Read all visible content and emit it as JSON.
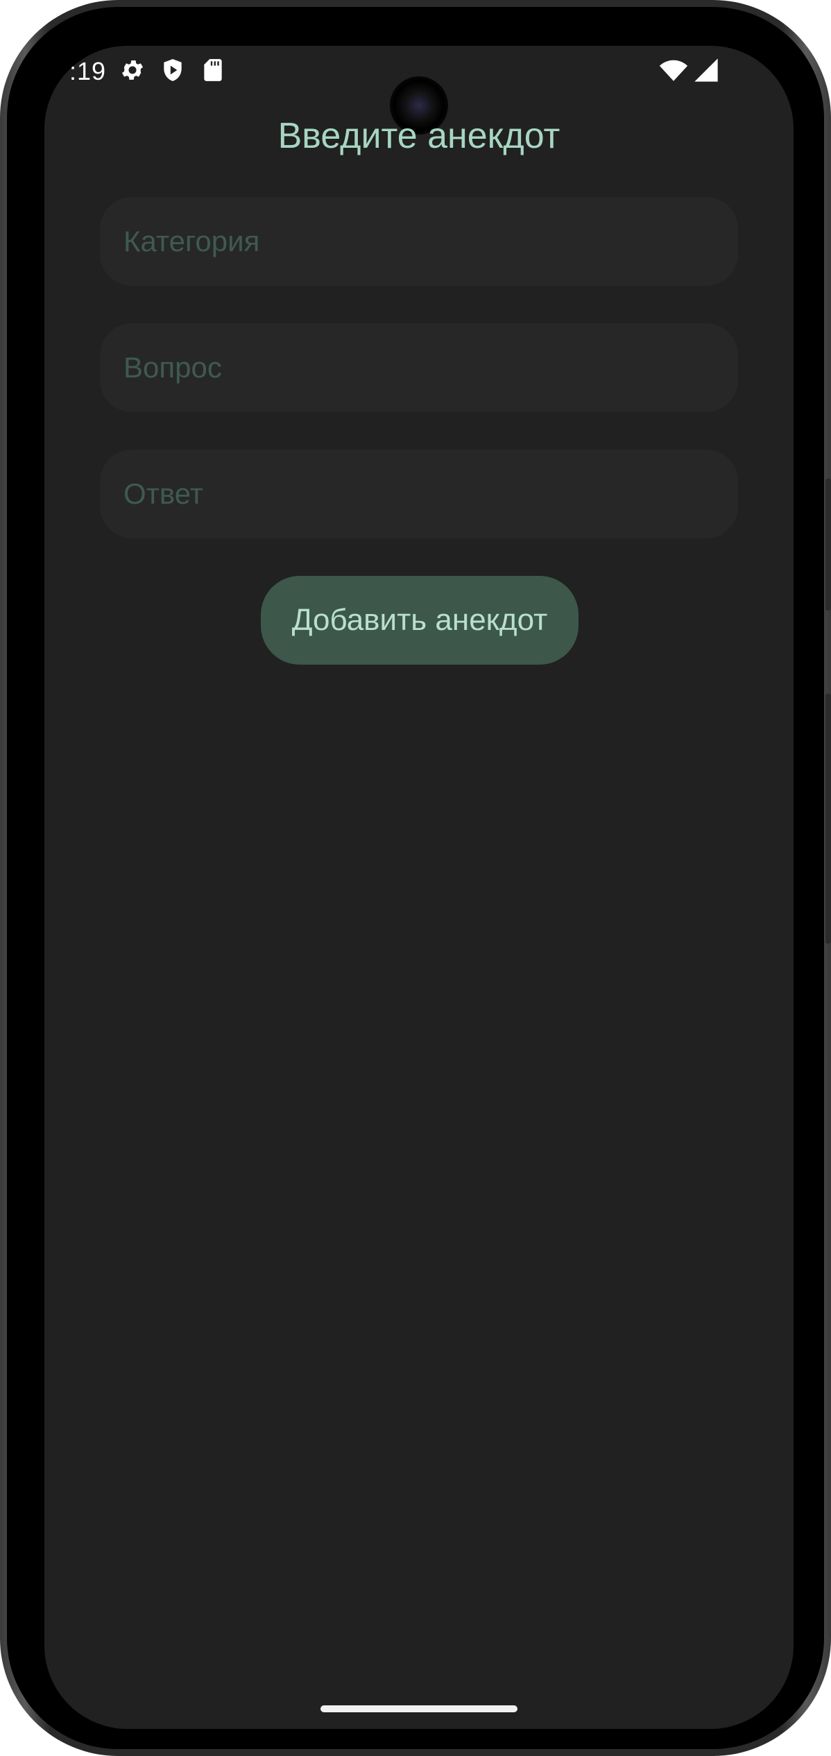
{
  "status_bar": {
    "time": ":19",
    "icons": [
      "gear-icon",
      "play-protect-icon",
      "sd-card-icon",
      "wifi-icon",
      "cellular-signal-icon"
    ]
  },
  "screen": {
    "title": "Введите анекдот",
    "fields": [
      {
        "name": "category",
        "placeholder": "Категория",
        "value": ""
      },
      {
        "name": "question",
        "placeholder": "Вопрос",
        "value": ""
      },
      {
        "name": "answer",
        "placeholder": "Ответ",
        "value": ""
      }
    ],
    "add_button_label": "Добавить анекдот"
  },
  "colors": {
    "background": "#212121",
    "field_background": "#272727",
    "placeholder": "#3f5a50",
    "accent_text": "#a7d6c2",
    "button_background": "#3d574b"
  }
}
